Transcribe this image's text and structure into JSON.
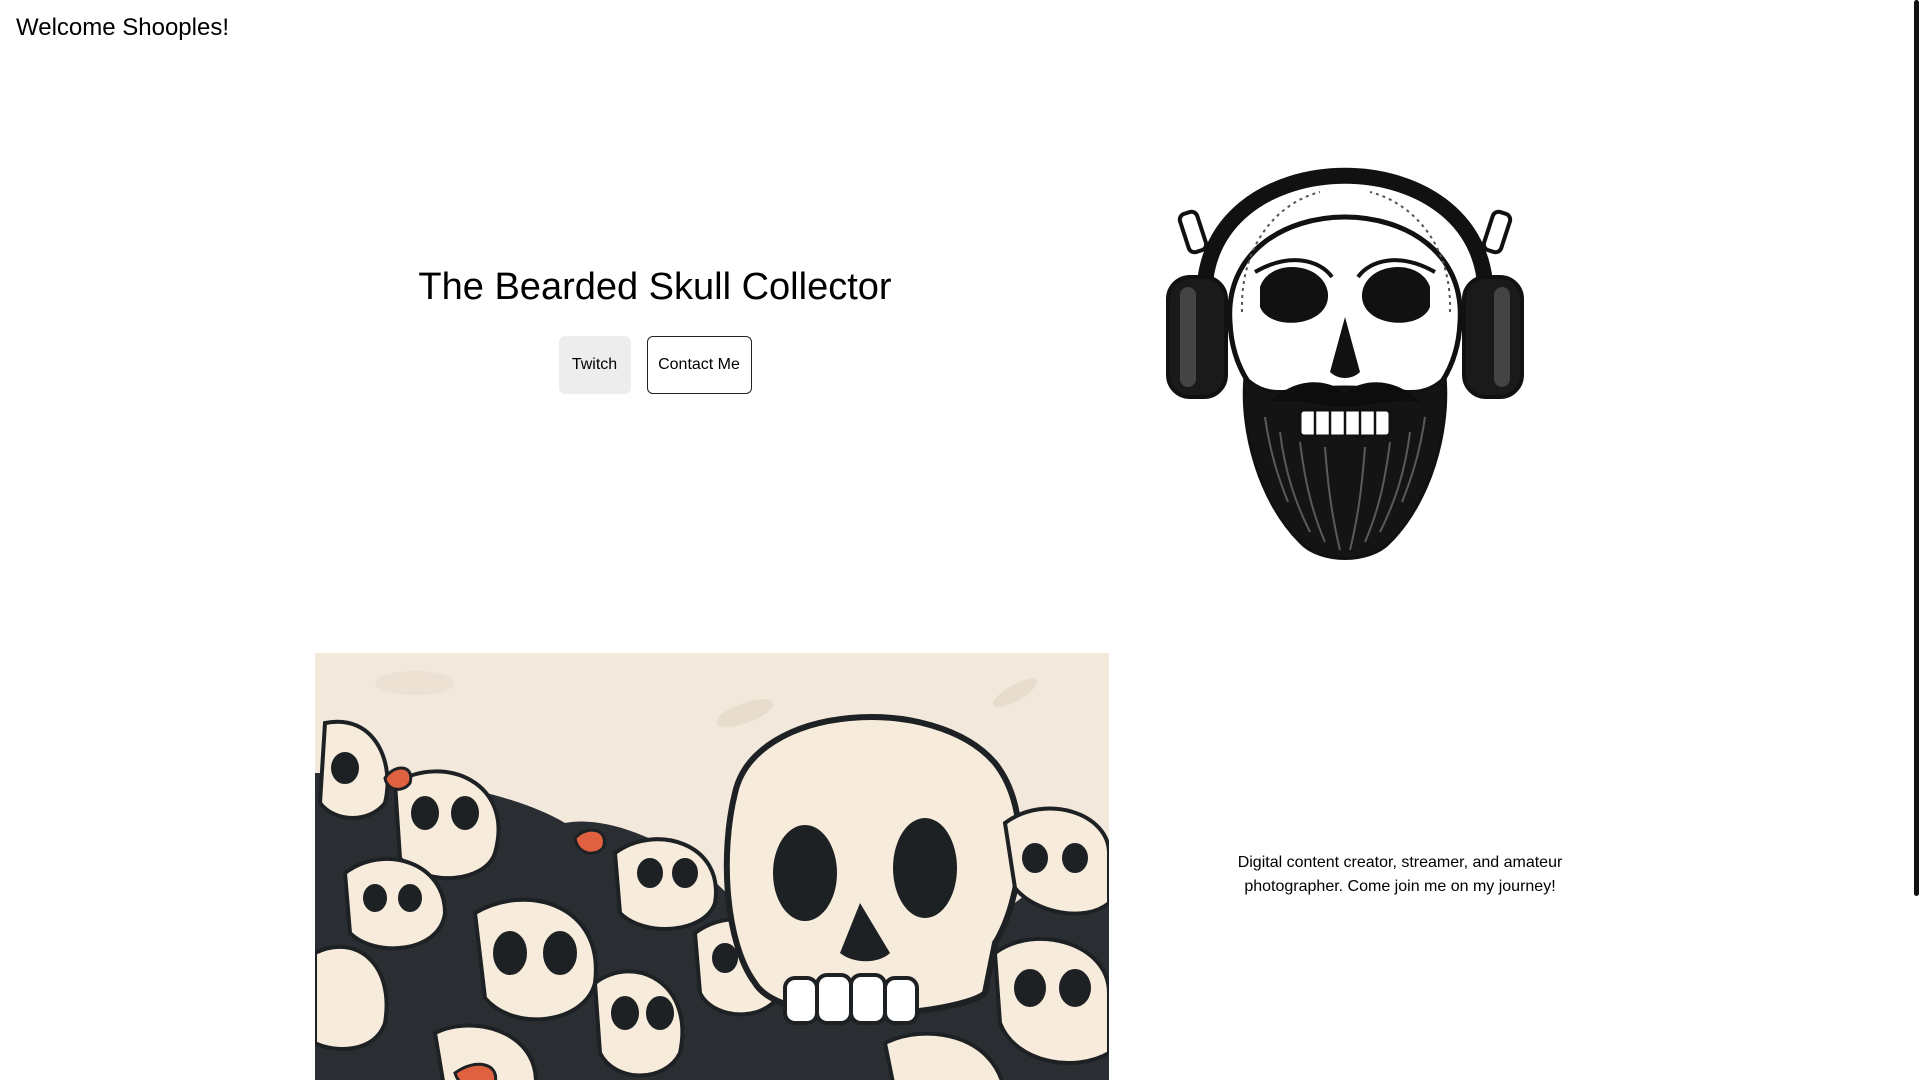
{
  "header": {
    "greeting": "Welcome Shooples!"
  },
  "hero": {
    "title": "The Bearded Skull Collector",
    "buttons": {
      "twitch_label": "Twitch",
      "contact_label": "Contact Me"
    },
    "portrait_icon": "bearded-skull-headphones-illustration"
  },
  "about": {
    "banner_icon": "skull-pile-illustration",
    "bio": "Digital content creator, streamer, and amateur photographer. Come join me on my journey!"
  },
  "colors": {
    "banner_background": "#f3e8dc",
    "skull_fill": "#f7ecdc",
    "skull_outline": "#1e2124",
    "accent_red": "#e0613f",
    "twitch_button_bg": "#ededed"
  }
}
